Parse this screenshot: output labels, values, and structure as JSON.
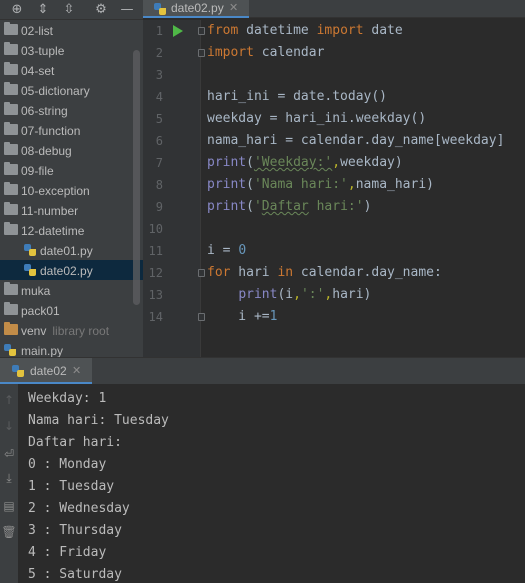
{
  "project_tree": {
    "items": [
      {
        "label": "02-list",
        "type": "folder"
      },
      {
        "label": "03-tuple",
        "type": "folder"
      },
      {
        "label": "04-set",
        "type": "folder"
      },
      {
        "label": "05-dictionary",
        "type": "folder"
      },
      {
        "label": "06-string",
        "type": "folder"
      },
      {
        "label": "07-function",
        "type": "folder"
      },
      {
        "label": "08-debug",
        "type": "folder"
      },
      {
        "label": "09-file",
        "type": "folder"
      },
      {
        "label": "10-exception",
        "type": "folder"
      },
      {
        "label": "11-number",
        "type": "folder"
      },
      {
        "label": "12-datetime",
        "type": "folder"
      },
      {
        "label": "date01.py",
        "type": "python-file"
      },
      {
        "label": "date02.py",
        "type": "python-file",
        "selected": true
      },
      {
        "label": "muka",
        "type": "folder"
      },
      {
        "label": "pack01",
        "type": "folder"
      },
      {
        "label": "venv",
        "type": "excluded-folder",
        "note": "library root"
      },
      {
        "label": "main.py",
        "type": "python-file"
      }
    ],
    "toolbar_icons": [
      "target-icon",
      "expand-all-icon",
      "collapse-all-icon",
      "gear-icon",
      "minimize-icon"
    ]
  },
  "editor": {
    "tab": {
      "label": "date02.py",
      "icon": "python-file-icon"
    },
    "line_numbers": [
      "1",
      "2",
      "3",
      "4",
      "5",
      "6",
      "7",
      "8",
      "9",
      "10",
      "11",
      "12",
      "13",
      "14"
    ],
    "lines": [
      "from datetime import date",
      "import calendar",
      "",
      "hari_ini = date.today()",
      "weekday = hari_ini.weekday()",
      "nama_hari = calendar.day_name[weekday]",
      "print('Weekday:',weekday)",
      "print('Nama hari:',nama_hari)",
      "print('Daftar hari:')",
      "",
      "i = 0",
      "for hari in calendar.day_name:",
      "    print(i,':',hari)",
      "    i +=1"
    ]
  },
  "run_panel": {
    "tab": {
      "label": "date02",
      "icon": "python-file-icon"
    },
    "side_icons": [
      "scroll-up-icon",
      "scroll-down-icon",
      "soft-wrap-icon",
      "scroll-to-end-icon",
      "print-icon",
      "trash-icon"
    ],
    "output": [
      "Weekday: 1",
      "Nama hari: Tuesday",
      "Daftar hari:",
      "0 : Monday",
      "1 : Tuesday",
      "2 : Wednesday",
      "3 : Thursday",
      "4 : Friday",
      "5 : Saturday"
    ]
  },
  "colors": {
    "keyword": "#cc7832",
    "builtin": "#8888c6",
    "string": "#6a8759",
    "number": "#6897bb",
    "run_arrow": "#4fb847",
    "selection": "#0d293e",
    "tab_underline": "#4a88c7"
  }
}
